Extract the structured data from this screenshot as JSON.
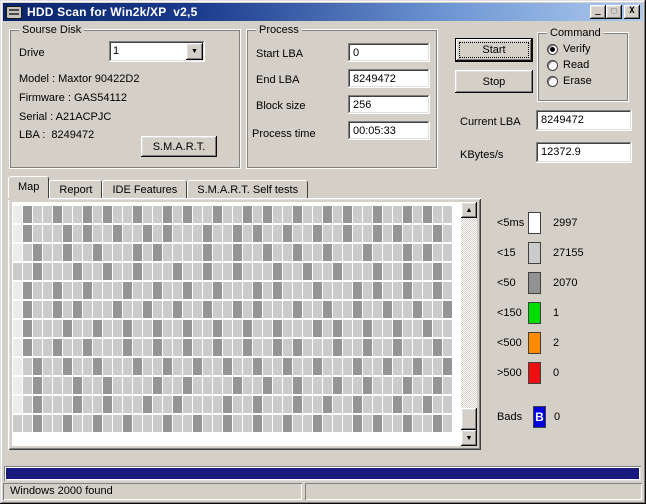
{
  "window": {
    "title": "HDD Scan for Win2k/XP  v2,5"
  },
  "titlebar": {
    "minimize_glyph": "_",
    "maximize_glyph": "□",
    "close_glyph": "X"
  },
  "source_disk": {
    "title": "Sourse Disk",
    "drive_label": "Drive",
    "drive_value": "1",
    "info": [
      "Model : Maxtor 90422D2",
      "Firmware : GAS54112",
      "Serial : A21ACPJC",
      "LBA :  8249472"
    ],
    "smart_button": "S.M.A.R.T."
  },
  "process": {
    "title": "Process",
    "fields": [
      {
        "label": "Start LBA",
        "value": "0"
      },
      {
        "label": "End LBA",
        "value": "8249472"
      },
      {
        "label": "Block size",
        "value": "256"
      },
      {
        "label": "Process time",
        "value": "00:05:33"
      }
    ]
  },
  "controls": {
    "start_button": "Start",
    "stop_button": "Stop",
    "command": {
      "title": "Command",
      "options": [
        {
          "label": "Verify",
          "selected": true
        },
        {
          "label": "Read",
          "selected": false
        },
        {
          "label": "Erase",
          "selected": false
        }
      ]
    },
    "current_lba": {
      "label": "Current LBA",
      "value": "8249472"
    },
    "kbytes": {
      "label": "KBytes/s",
      "value": "12372.9"
    }
  },
  "tabs": {
    "active": "Map",
    "items": [
      "Map",
      "Report",
      "IDE Features",
      "S.M.A.R.T. Self tests"
    ]
  },
  "legend": {
    "items": [
      {
        "label": "<5ms",
        "color": "#ffffff",
        "count": "2997"
      },
      {
        "label": "<15",
        "color": "#cbcbcb",
        "count": "27155"
      },
      {
        "label": "<50",
        "color": "#929292",
        "count": "2070"
      },
      {
        "label": "<150",
        "color": "#00dd00",
        "count": "1"
      },
      {
        "label": "<500",
        "color": "#ff8a00",
        "count": "2"
      },
      {
        "label": ">500",
        "color": "#ee1010",
        "count": "0"
      }
    ],
    "bads": {
      "label": "Bads",
      "color": "#0000dd",
      "glyph": "B",
      "count": "0"
    }
  },
  "map": {
    "colors": {
      "W": "#ececec",
      "L": "#cbcbcb",
      "D": "#959595"
    },
    "rows": [
      "WDLLDLLDLDLLDLLDLDLLDLLDLDLLDLLDLDLLDLLDLDLL",
      "WDLLLDLDLLDLLDLDLLLDLLDLDLLDLLDLLDLLDLDLLLDL",
      "WLDLLDLLDLLLDLDLLLLDLLDLLDLLDLLDLLLDLLLDLDLL",
      "LLDLLLDLLDLLDLLLDLLDLLDLLLDLLDLLDLLLDLLDLLDL",
      "WDLLDLLDLLLDLLDLLDLLDLLLDLDLLLDLLLDLDLLDLLDL",
      "WDLLDLDLLLDLLDLLDLLDLLDLDLLLDLLDLLDLLDLLDLLD",
      "WDLLLDLLDLLDLLDLLDLLDLLDLLDLLLDLDLLDLLDLLDLL",
      "WDLLDLLDLLLDLLDLLDLLDLLDLLDLDLLLDLLDLLDLLLDL",
      "WLDLLDLLDLLLDLLDLLDLLDLLDLLDLLDLLLDLLDLLDLLD",
      "WLDLLLDLLDLLLLDLLDLLLLDLLDLLDLLLDLLDLLLDLLDL",
      "WLDLLLDLLDLLLDLLDLLLLDLLDLLLDLLDLLDLLLDLLDLL",
      "LLDLLDLLDLLDLLLDLLDLLDLLDLLDLLDLLLDLDLLDLLDL"
    ]
  },
  "progress": {
    "color": "#1a1a7e",
    "percent": 100
  },
  "statusbar": {
    "text": "Windows 2000 found"
  }
}
